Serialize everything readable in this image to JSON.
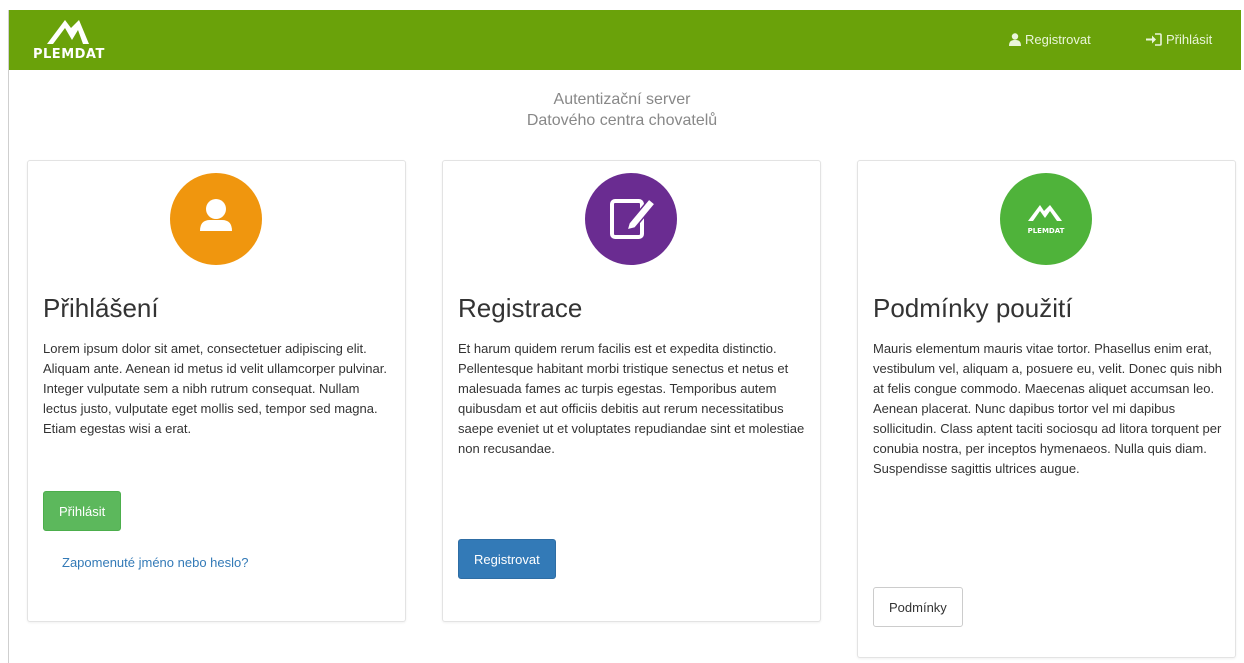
{
  "navbar": {
    "brand": "PLEMDAT",
    "register_label": "Registrovat",
    "login_label": "Přihlásit",
    "color": "#6aa20a"
  },
  "header": {
    "line1": "Autentizační server",
    "line2": "Datového centra chovatelů"
  },
  "cards": [
    {
      "icon": "user-icon",
      "color": "#f0960e",
      "title": "Přihlášení",
      "text": "Lorem ipsum dolor sit amet, consectetuer adipiscing elit. Aliquam ante. Aenean id metus id velit ullamcorper pulvinar. Integer vulputate sem a nibh rutrum consequat. Nullam lectus justo, vulputate eget mollis sed, tempor sed magna. Etiam egestas wisi a erat.",
      "button": "Přihlásit",
      "link": "Zapomenuté jméno nebo heslo?"
    },
    {
      "icon": "edit-icon",
      "color": "#6a2c91",
      "title": "Registrace",
      "text": "Et harum quidem rerum facilis est et expedita distinctio. Pellentesque habitant morbi tristique senectus et netus et malesuada fames ac turpis egestas. Temporibus autem quibusdam et aut officiis debitis aut rerum necessitatibus saepe eveniet ut et voluptates repudiandae sint et molestiae non recusandae.",
      "button": "Registrovat"
    },
    {
      "icon": "plemdat-logo-icon",
      "icon_text": "PLEMDAT",
      "color": "#4fb33a",
      "title": "Podmínky použití",
      "text": "Mauris elementum mauris vitae tortor. Phasellus enim erat, vestibulum vel, aliquam a, posuere eu, velit. Donec quis nibh at felis congue commodo. Maecenas aliquet accumsan leo. Aenean placerat. Nunc dapibus tortor vel mi dapibus sollicitudin. Class aptent taciti sociosqu ad litora torquent per conubia nostra, per inceptos hymenaeos. Nulla quis diam. Suspendisse sagittis ultrices augue.",
      "button": "Podmínky"
    }
  ]
}
